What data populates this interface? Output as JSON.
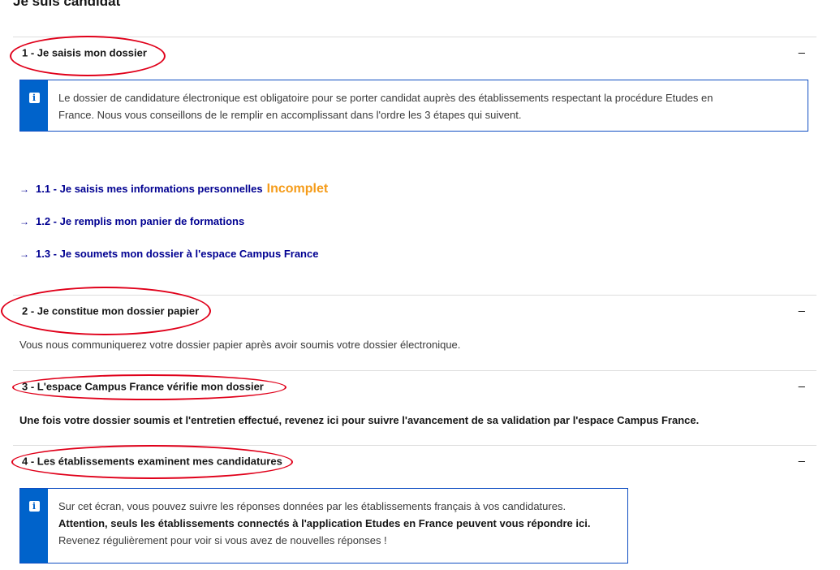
{
  "page": {
    "title": "Je suis candidat"
  },
  "sections": [
    {
      "title": "1 - Je saisis mon dossier",
      "toggle": "–",
      "info": {
        "line1": "Le dossier de candidature électronique est obligatoire pour se porter candidat auprès des établissements respectant la procédure Etudes en",
        "line2": "France. Nous vous conseillons de le remplir en accomplissant dans l'ordre les 3 étapes qui suivent."
      },
      "steps": [
        {
          "arrow": "→",
          "label": "1.1 - Je saisis mes informations personnelles",
          "status": "Incomplet"
        },
        {
          "arrow": "→",
          "label": "1.2 - Je remplis mon panier de formations"
        },
        {
          "arrow": "→",
          "label": "1.3 - Je soumets mon dossier à l'espace Campus France"
        }
      ]
    },
    {
      "title": "2 - Je constitue mon dossier papier",
      "toggle": "–",
      "body": "Vous nous communiquerez votre dossier papier après avoir soumis votre dossier électronique."
    },
    {
      "title": "3 - L'espace Campus France vérifie mon dossier",
      "toggle": "–",
      "body": "Une fois votre dossier soumis et l'entretien effectué, revenez ici pour suivre l'avancement de sa validation par l'espace Campus France."
    },
    {
      "title": "4 - Les établissements examinent mes candidatures",
      "toggle": "–",
      "info": {
        "line1": "Sur cet écran, vous pouvez suivre les réponses données par les établissements français à vos candidatures.",
        "line2": "Attention, seuls les établissements connectés à l'application Etudes en France peuvent vous répondre ici.",
        "line3": "Revenez régulièrement pour voir si vous avez de nouvelles réponses !"
      }
    }
  ],
  "icons": {
    "info": "info-icon",
    "arrow": "arrow-right-icon",
    "toggle": "minus-icon"
  },
  "colors": {
    "link": "#000091",
    "status_incomplete": "#f59c1a",
    "info_bar": "#0063cb",
    "annotation": "#e0001a"
  }
}
